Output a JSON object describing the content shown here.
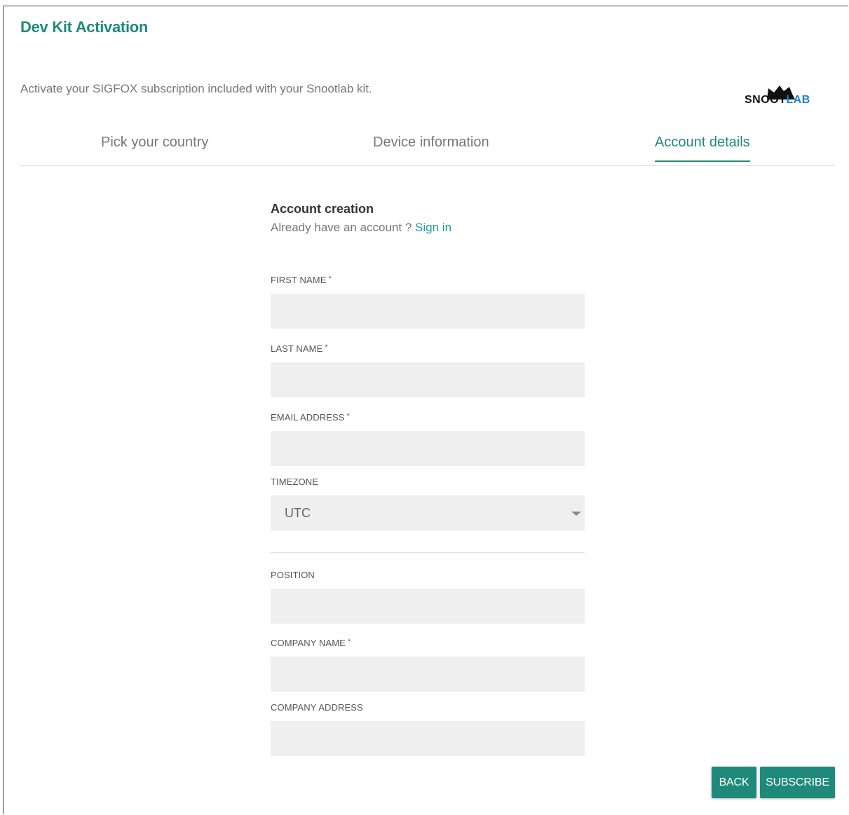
{
  "header": {
    "title": "Dev Kit Activation",
    "subtitle": "Activate your SIGFOX subscription included with your Snootlab kit."
  },
  "logo": {
    "part1": "SN",
    "part2": "OOT",
    "part3": "LAB",
    "icon": "cat-ears-logo-icon"
  },
  "tabs": [
    {
      "label": "Pick your country",
      "active": false
    },
    {
      "label": "Device information",
      "active": false
    },
    {
      "label": "Account details",
      "active": true
    }
  ],
  "form": {
    "heading": "Account creation",
    "already_text": "Already have an account ?",
    "signin_link": "Sign in",
    "fields": {
      "first_name": {
        "label": "FIRST NAME",
        "required": "*",
        "value": ""
      },
      "last_name": {
        "label": "LAST NAME",
        "required": "*",
        "value": ""
      },
      "email": {
        "label": "EMAIL ADDRESS",
        "required": "*",
        "value": ""
      },
      "timezone": {
        "label": "TIMEZONE",
        "value": "UTC"
      },
      "position": {
        "label": "POSITION",
        "value": ""
      },
      "company_name": {
        "label": "COMPANY NAME",
        "required": "*",
        "value": ""
      },
      "company_address": {
        "label": "COMPANY ADDRESS",
        "value": ""
      }
    }
  },
  "buttons": {
    "back": "BACK",
    "subscribe": "SUBSCRIBE"
  },
  "colors": {
    "accent": "#1f8a7b",
    "link": "#1e9aa0",
    "input_bg": "#efefef",
    "required": "#d33333"
  }
}
